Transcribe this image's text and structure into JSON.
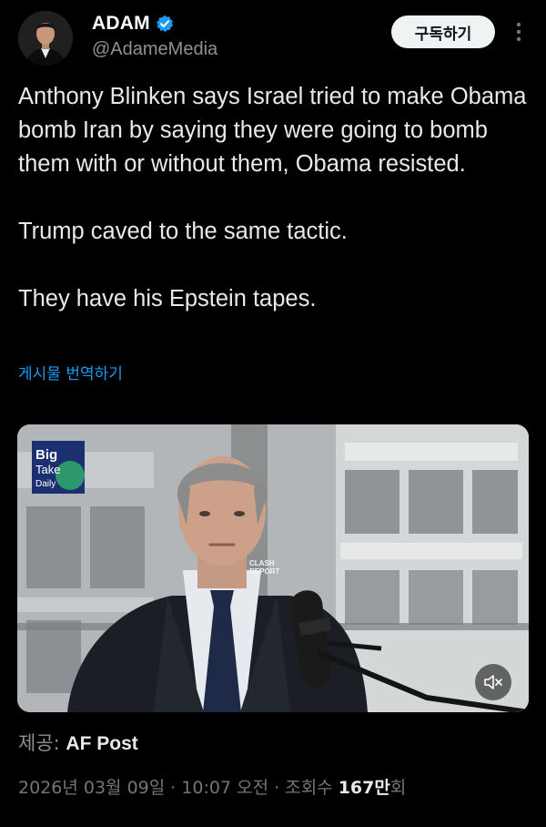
{
  "author": {
    "display_name": "ADAM",
    "handle": "@AdameMedia",
    "verified": true
  },
  "actions": {
    "subscribe_label": "구독하기",
    "more_icon": "more-vertical-icon"
  },
  "tweet": {
    "paragraphs": [
      "Anthony Blinken says Israel tried to make Obama bomb Iran by saying they were going to bomb them with or without them, Obama resisted.",
      "Trump caved to the same tactic.",
      "They have his Epstein tapes."
    ],
    "translate_label": "게시물 번역하기"
  },
  "media": {
    "logo_text": [
      "Big",
      "Take",
      "Daily"
    ],
    "watermark": [
      "CLASH",
      "REPORT"
    ],
    "mute_icon": "speaker-muted-icon"
  },
  "source": {
    "label": "제공:",
    "name": "AF Post"
  },
  "meta": {
    "timestamp": "2026년 03월 09일 · 10:07 오전 · ",
    "views_label": "조회수 ",
    "views_count": "167만",
    "views_suffix": "회"
  },
  "colors": {
    "background": "#000000",
    "text": "#e7e9ea",
    "secondary": "#71767b",
    "link": "#1d9bf0",
    "verified_badge": "#1d9bf0"
  }
}
